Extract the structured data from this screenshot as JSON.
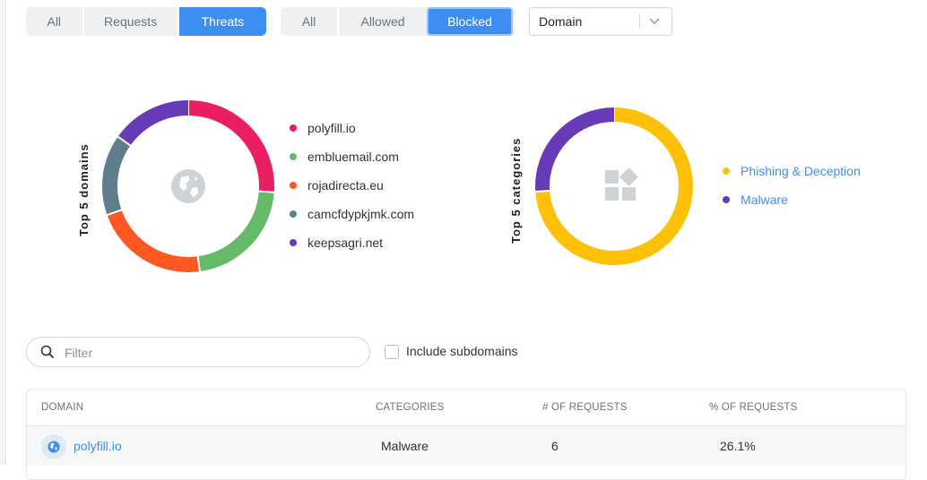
{
  "view_tabs": [
    {
      "label": "All",
      "active": false
    },
    {
      "label": "Requests",
      "active": false
    },
    {
      "label": "Threats",
      "active": true
    }
  ],
  "status_tabs": [
    {
      "label": "All",
      "active": false
    },
    {
      "label": "Allowed",
      "active": false
    },
    {
      "label": "Blocked",
      "active": true
    }
  ],
  "group_by": {
    "value": "Domain"
  },
  "domains_chart": {
    "title": "Top 5 domains",
    "center_icon": "globe-icon",
    "slices": [
      {
        "label": "polyfill.io",
        "color": "#e91e63",
        "value": 26.1
      },
      {
        "label": "embluemail.com",
        "color": "#66bb6a",
        "value": 21.7
      },
      {
        "label": "rojadirecta.eu",
        "color": "#ff5722",
        "value": 21.7
      },
      {
        "label": "camcfdypkjmk.com",
        "color": "#607d8b",
        "value": 15.2
      },
      {
        "label": "keepsagri.net",
        "color": "#673ab7",
        "value": 15.2
      }
    ]
  },
  "categories_chart": {
    "title": "Top 5 categories",
    "center_icon": "categories-icon",
    "slices": [
      {
        "label": "Phishing & Deception",
        "color": "#ffc107",
        "value": 73.9
      },
      {
        "label": "Malware",
        "color": "#673ab7",
        "value": 26.1
      }
    ]
  },
  "filter": {
    "placeholder": "Filter",
    "value": ""
  },
  "include_subdomains": {
    "label": "Include subdomains",
    "checked": false
  },
  "table": {
    "columns": [
      "DOMAIN",
      "CATEGORIES",
      "# OF REQUESTS",
      "% OF REQUESTS"
    ],
    "rows": [
      {
        "domain": "polyfill.io",
        "category": "Malware",
        "requests": "6",
        "percent": "26.1%"
      }
    ]
  }
}
